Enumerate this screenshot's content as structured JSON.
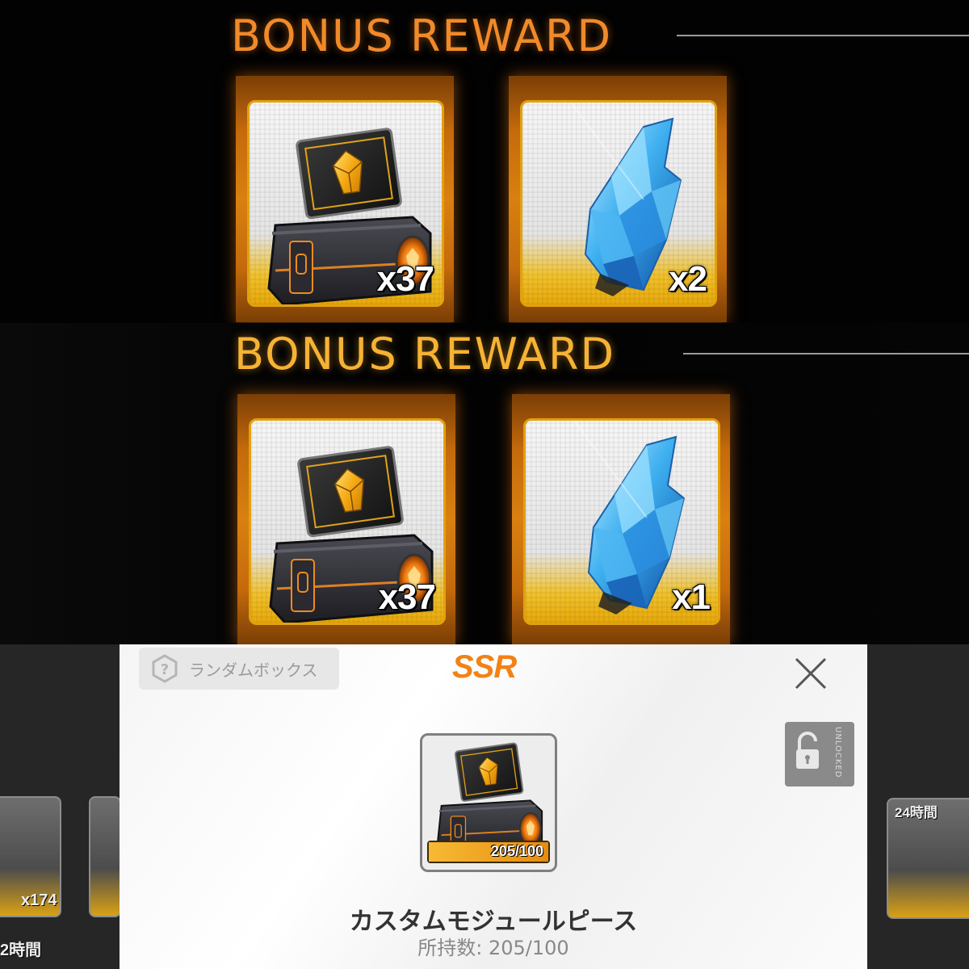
{
  "panels": [
    {
      "title": "BONUS REWARD",
      "rewards": [
        {
          "item": "custom-module-box",
          "quantity": "x37"
        },
        {
          "item": "blue-crystal",
          "quantity": "x2"
        }
      ]
    },
    {
      "title": "BONUS REWARD",
      "rewards": [
        {
          "item": "custom-module-box",
          "quantity": "x37"
        },
        {
          "item": "blue-crystal",
          "quantity": "x1"
        }
      ]
    }
  ],
  "popup": {
    "category": "ランダムボックス",
    "rarity": "SSR",
    "lock_state": "UNLOCKED",
    "item_name": "カスタムモジュールピース",
    "owned": "所持数: 205/100",
    "progress_label": "205/100",
    "progress_fraction": 1.0,
    "background": {
      "left_badge": "x174",
      "left_timer": "2時間",
      "right_timer": "24時間"
    }
  },
  "colors": {
    "title_orange": "#f08a2a",
    "title_gold": "#f6b234",
    "rarity_orange": "#f28216",
    "card_border": "#e2a10f"
  }
}
